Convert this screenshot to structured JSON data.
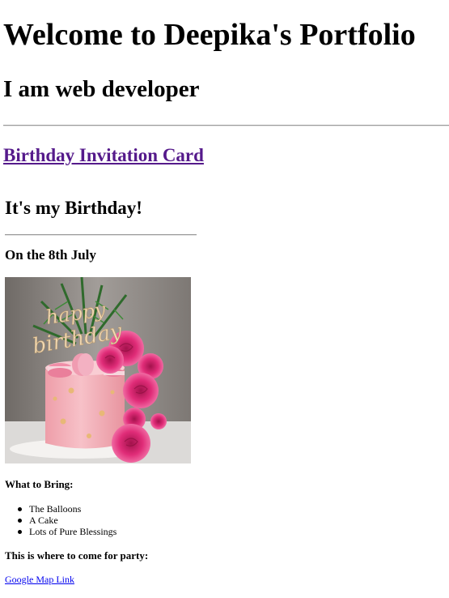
{
  "header": {
    "title": "Welcome to Deepika's Portfolio",
    "subtitle": "I am web developer"
  },
  "nav": {
    "link_label": "Birthday Invitation Card"
  },
  "invitation": {
    "heading": "It's my Birthday!",
    "date": "On the 8th July",
    "cake_topper_text": "happy birthday",
    "bring_heading": "What to Bring:",
    "bring_items": [
      "The Balloons",
      "A Cake",
      "Lots of Pure Blessings"
    ],
    "location_heading": "This is where to come for party:",
    "map_link_label": "Google Map Link"
  },
  "colors": {
    "visited_link": "#551a8b",
    "link": "#0000ee",
    "cake_pink": "#f6b4bf",
    "rose_pink": "#e62f7e"
  }
}
